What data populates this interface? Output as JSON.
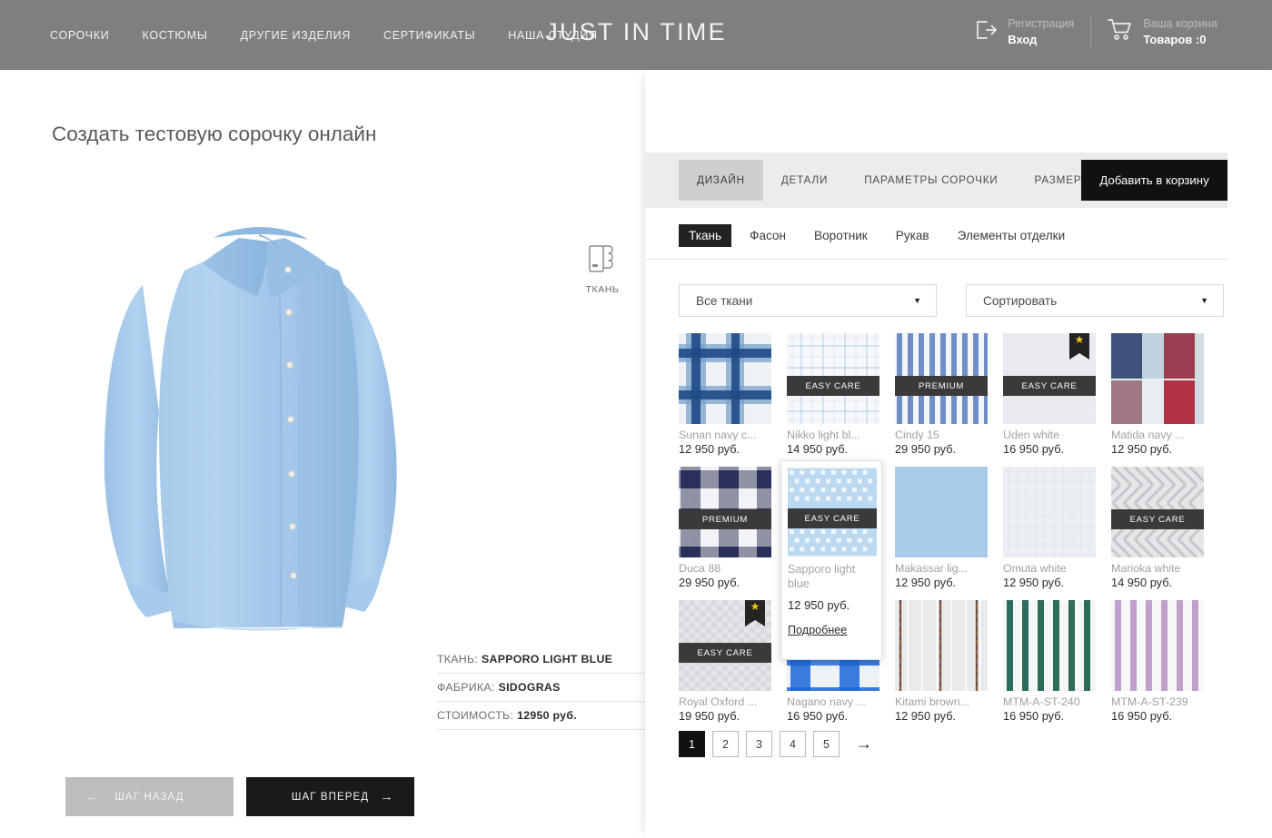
{
  "header": {
    "brand": "JUST IN TIME",
    "nav": [
      {
        "label": "СОРОЧКИ"
      },
      {
        "label": "КОСТЮМЫ"
      },
      {
        "label": "ДРУГИЕ ИЗДЕЛИЯ"
      },
      {
        "label": "СЕРТИФИКАТЫ"
      },
      {
        "label": "НАША СТУДИЯ"
      }
    ],
    "account": {
      "top": "Регистрация",
      "bottom": "Вход",
      "icon": "login-icon"
    },
    "cart": {
      "top": "Ваша корзина",
      "bottom": "Товаров :0",
      "icon": "cart-icon"
    },
    "bg_color": "#7f7f7f"
  },
  "left": {
    "page_title": "Создать тестовую сорочку онлайн",
    "fabric_icon_label": "ТКАНЬ",
    "preview_alt": "light-blue-dress-shirt-preview",
    "shirt_color": "#9dc2e8",
    "info": [
      {
        "label": "ТКАНЬ:",
        "value": "SAPPORO LIGHT BLUE"
      },
      {
        "label": "ФАБРИКА:",
        "value": "SIDOGRAS"
      },
      {
        "label": "СТОИМОСТЬ:",
        "value": "12950 руб."
      }
    ],
    "buttons": {
      "back": "ШАГ НАЗАД",
      "forward": "ШАГ ВПЕРЕД",
      "back_arrow": "←",
      "forward_arrow": "→"
    }
  },
  "panel": {
    "tabs": [
      {
        "label": "ДИЗАЙН",
        "active": true
      },
      {
        "label": "ДЕТАЛИ",
        "active": false
      },
      {
        "label": "ПАРАМЕТРЫ СОРОЧКИ",
        "active": false
      },
      {
        "label": "РАЗМЕРЫ",
        "active": false
      }
    ],
    "cart_button": "Добавить в корзину",
    "subtabs": [
      {
        "label": "Ткань",
        "active": true
      },
      {
        "label": "Фасон",
        "active": false
      },
      {
        "label": "Воротник",
        "active": false
      },
      {
        "label": "Рукав",
        "active": false
      },
      {
        "label": "Элементы отделки",
        "active": false
      }
    ],
    "filter_select": {
      "value": "Все ткани",
      "caret": "▼"
    },
    "sort_select": {
      "value": "Сортировать",
      "caret": "▼"
    },
    "popup": {
      "name": "Sapporo light blue",
      "price": "12 950 руб.",
      "more_link": "Подробнее",
      "badge": "EASY CARE"
    },
    "pagination": {
      "pages": [
        "1",
        "2",
        "3",
        "4",
        "5"
      ],
      "active": "1",
      "next_arrow": "→"
    }
  },
  "fabrics": [
    {
      "name": "Sunan navy c...",
      "price": "12 950 руб.",
      "badge": "",
      "star": false,
      "pattern": "check-blue"
    },
    {
      "name": "Nikko light bl...",
      "price": "14 950 руб.",
      "badge": "EASY CARE",
      "star": false,
      "pattern": "fine-check-lightblue"
    },
    {
      "name": "Cindy 15",
      "price": "29 950 руб.",
      "badge": "PREMIUM",
      "star": false,
      "pattern": "stripe-blue"
    },
    {
      "name": "Uden white",
      "price": "16 950 руб.",
      "badge": "EASY CARE",
      "star": true,
      "pattern": "plain-white"
    },
    {
      "name": "Matida navy ...",
      "price": "12 950 руб.",
      "badge": "",
      "star": false,
      "pattern": "check-navy-red"
    },
    {
      "name": "Duca 88",
      "price": "29 950 руб.",
      "badge": "PREMIUM",
      "star": false,
      "pattern": "check-grey-navy"
    },
    {
      "name": "Sapporo light blue",
      "price": "12 950 руб.",
      "badge": "EASY CARE",
      "star": false,
      "pattern": "dobby-lightblue",
      "selected": true
    },
    {
      "name": "Makassar lig...",
      "price": "12 950 руб.",
      "badge": "",
      "star": false,
      "pattern": "plain-lightblue"
    },
    {
      "name": "Omuta white",
      "price": "12 950 руб.",
      "badge": "",
      "star": false,
      "pattern": "texture-white"
    },
    {
      "name": "Marioka white",
      "price": "14 950 руб.",
      "badge": "EASY CARE",
      "star": false,
      "pattern": "herringbone-grey"
    },
    {
      "name": "Royal Oxford ...",
      "price": "19 950 руб.",
      "badge": "EASY CARE",
      "star": true,
      "pattern": "oxford-white"
    },
    {
      "name": "Nagano navy ...",
      "price": "16 950 руб.",
      "badge": "",
      "star": false,
      "pattern": "check-bright-blue"
    },
    {
      "name": "Kitami brown...",
      "price": "12 950 руб.",
      "badge": "",
      "star": false,
      "pattern": "stripe-brown"
    },
    {
      "name": "MTM-A-ST-240",
      "price": "16 950 руб.",
      "badge": "",
      "star": false,
      "pattern": "stripe-green"
    },
    {
      "name": "MTM-A-ST-239",
      "price": "16 950 руб.",
      "badge": "",
      "star": false,
      "pattern": "stripe-lilac"
    }
  ]
}
